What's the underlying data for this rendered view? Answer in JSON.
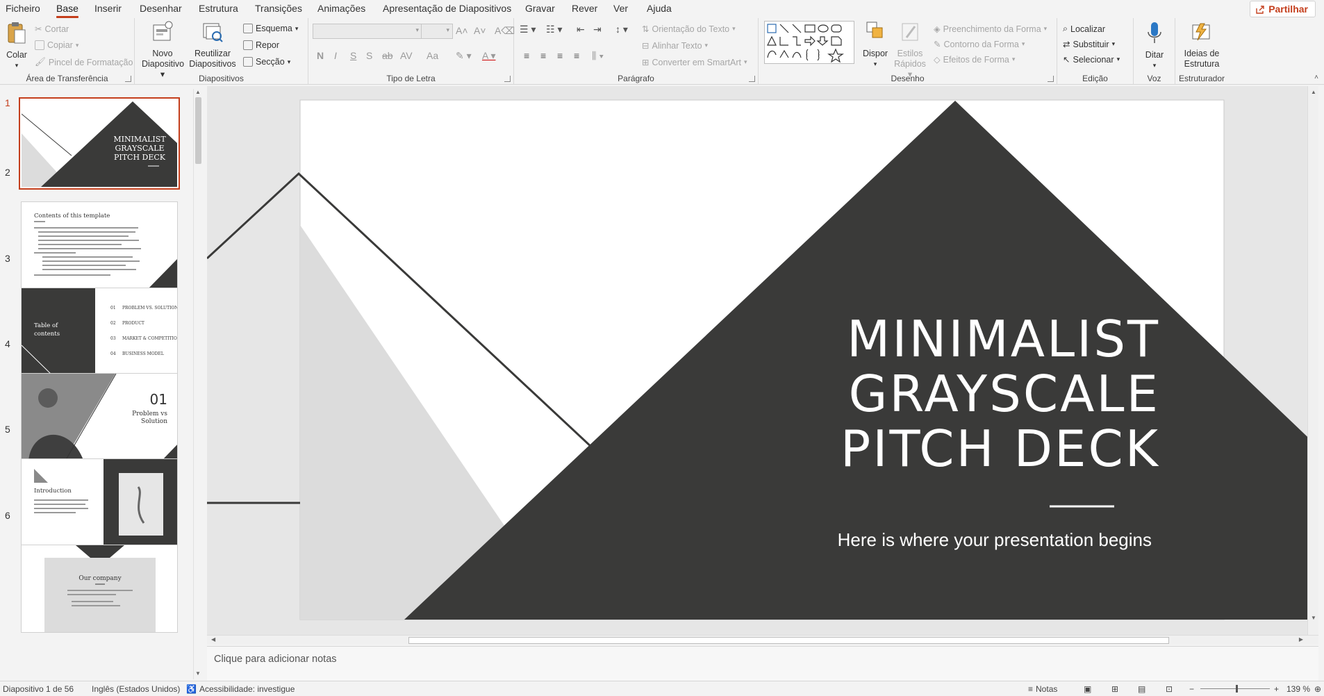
{
  "menu": {
    "tabs": [
      "Ficheiro",
      "Base",
      "Inserir",
      "Desenhar",
      "Estrutura",
      "Transições",
      "Animações",
      "Apresentação de Diapositivos",
      "Gravar",
      "Rever",
      "Ver",
      "Ajuda"
    ],
    "active_tab": "Base",
    "share_label": "Partilhar"
  },
  "ribbon": {
    "clipboard": {
      "label": "Área de Transferência",
      "paste": "Colar",
      "cut": "Cortar",
      "copy": "Copiar",
      "format_painter": "Pincel de Formatação"
    },
    "slides": {
      "label": "Diapositivos",
      "new_slide_1": "Novo",
      "new_slide_2": "Diapositivo",
      "reuse_1": "Reutilizar",
      "reuse_2": "Diapositivos",
      "layout": "Esquema",
      "reset": "Repor",
      "section": "Secção"
    },
    "font": {
      "label": "Tipo de Letra",
      "bold": "N",
      "italic": "I",
      "underline": "S",
      "shadow": "S",
      "strike": "ab",
      "spacing": "AV",
      "case": "Aa"
    },
    "paragraph": {
      "label": "Parágrafo",
      "text_direction": "Orientação do Texto",
      "align_text": "Alinhar Texto",
      "smartart": "Converter em SmartArt"
    },
    "drawing": {
      "label": "Desenho",
      "arrange": "Dispor",
      "quick_styles_1": "Estilos",
      "quick_styles_2": "Rápidos",
      "shape_fill": "Preenchimento da Forma",
      "shape_outline": "Contorno da Forma",
      "shape_effects": "Efeitos de Forma"
    },
    "editing": {
      "label": "Edição",
      "find": "Localizar",
      "replace": "Substituir",
      "select": "Selecionar"
    },
    "voice": {
      "label": "Voz",
      "dictate": "Ditar"
    },
    "designer": {
      "label": "Estruturador",
      "ideas_1": "Ideias de",
      "ideas_2": "Estrutura"
    }
  },
  "thumbnails": [
    {
      "num": "1",
      "text": "MINIMALIST GRAYSCALE PITCH DECK"
    },
    {
      "num": "2",
      "text": "Contents of this template"
    },
    {
      "num": "3",
      "text": "Table of contents"
    },
    {
      "num": "4",
      "text": "01 Problem vs Solution"
    },
    {
      "num": "5",
      "text": "Introduction"
    },
    {
      "num": "6",
      "text": "Our company"
    }
  ],
  "slide": {
    "title_line1": "MINIMALIST",
    "title_line2": "GRAYSCALE",
    "title_line3": "PITCH DECK",
    "subtitle": "Here is where your presentation begins"
  },
  "notes_placeholder": "Clique para adicionar notas",
  "status": {
    "slide_count": "Diapositivo 1 de 56",
    "language": "Inglês (Estados Unidos)",
    "accessibility": "Acessibilidade: investigue",
    "notes": "Notas",
    "zoom": "139 %"
  },
  "colors": {
    "accent": "#c43e1c",
    "slide_dark": "#3a3a39",
    "slide_light": "#dcdcdc"
  }
}
